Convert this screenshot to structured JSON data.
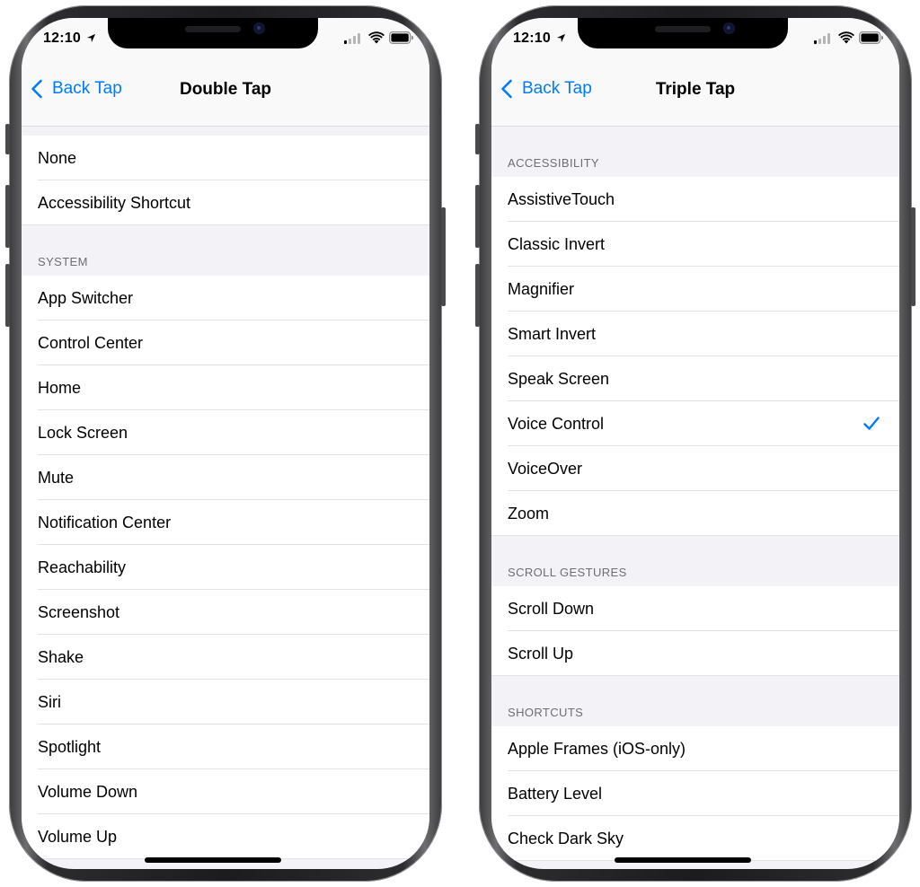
{
  "colors": {
    "accent": "#007aff",
    "group_background": "#f2f2f7",
    "bezel": "#1c1c1e"
  },
  "left_screen": {
    "status": {
      "time": "12:10"
    },
    "nav": {
      "back_label": "Back Tap",
      "title": "Double Tap"
    },
    "top_items": [
      "None",
      "Accessibility Shortcut"
    ],
    "system": {
      "header": "SYSTEM",
      "items": [
        "App Switcher",
        "Control Center",
        "Home",
        "Lock Screen",
        "Mute",
        "Notification Center",
        "Reachability",
        "Screenshot",
        "Shake",
        "Siri",
        "Spotlight",
        "Volume Down",
        "Volume Up"
      ]
    }
  },
  "right_screen": {
    "status": {
      "time": "12:10"
    },
    "nav": {
      "back_label": "Back Tap",
      "title": "Triple Tap"
    },
    "accessibility": {
      "header": "ACCESSIBILITY",
      "items": [
        "AssistiveTouch",
        "Classic Invert",
        "Magnifier",
        "Smart Invert",
        "Speak Screen",
        "Voice Control",
        "VoiceOver",
        "Zoom"
      ],
      "selected": "Voice Control"
    },
    "scroll_gestures": {
      "header": "SCROLL GESTURES",
      "items": [
        "Scroll Down",
        "Scroll Up"
      ]
    },
    "shortcuts": {
      "header": "SHORTCUTS",
      "items": [
        "Apple Frames (iOS-only)",
        "Battery Level",
        "Check Dark Sky"
      ]
    }
  }
}
